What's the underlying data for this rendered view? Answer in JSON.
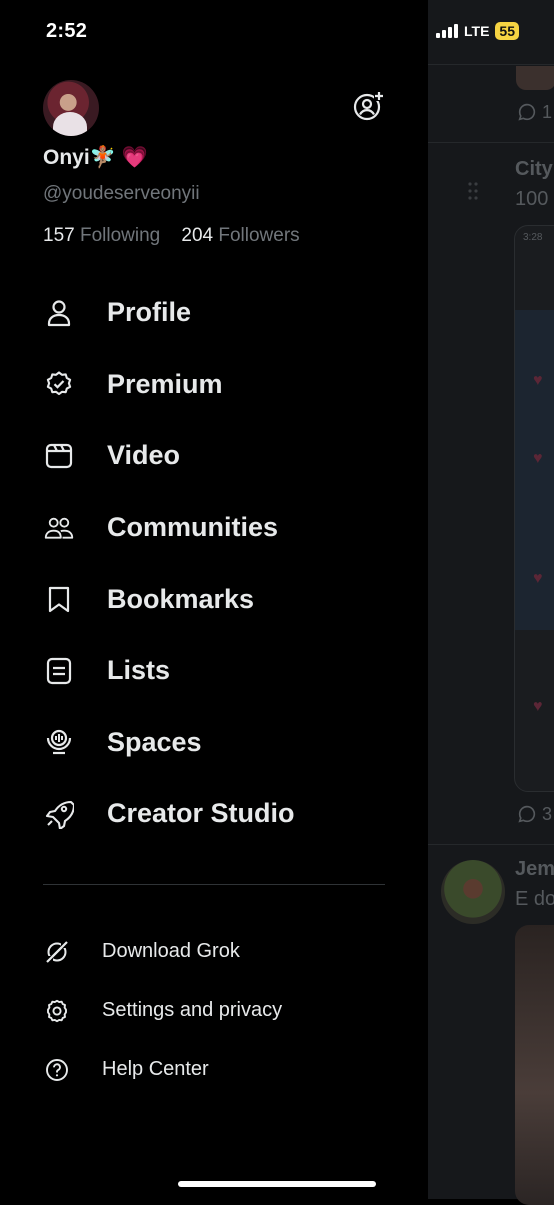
{
  "status_bar": {
    "time": "2:52",
    "network": "LTE",
    "battery": "55"
  },
  "profile": {
    "display_name": "Onyi🧚🏽 💗",
    "handle": "@youdeserveonyii",
    "following_count": "157",
    "following_label": "Following",
    "followers_count": "204",
    "followers_label": "Followers"
  },
  "nav": {
    "items": [
      {
        "label": "Profile",
        "icon": "person-icon"
      },
      {
        "label": "Premium",
        "icon": "verified-badge-icon"
      },
      {
        "label": "Video",
        "icon": "video-icon"
      },
      {
        "label": "Communities",
        "icon": "communities-icon"
      },
      {
        "label": "Bookmarks",
        "icon": "bookmark-icon"
      },
      {
        "label": "Lists",
        "icon": "list-icon"
      },
      {
        "label": "Spaces",
        "icon": "spaces-icon"
      },
      {
        "label": "Creator Studio",
        "icon": "rocket-icon"
      }
    ]
  },
  "secondary": {
    "items": [
      {
        "label": "Download Grok",
        "icon": "grok-icon"
      },
      {
        "label": "Settings and privacy",
        "icon": "gear-icon"
      },
      {
        "label": "Help Center",
        "icon": "help-icon"
      }
    ]
  },
  "background_feed": {
    "post1_meta": "1",
    "post2_name": "City",
    "post2_text": "100",
    "card_time": "3:28",
    "post2_meta": "3",
    "post3_name": "Jem",
    "post3_text": "E do"
  }
}
